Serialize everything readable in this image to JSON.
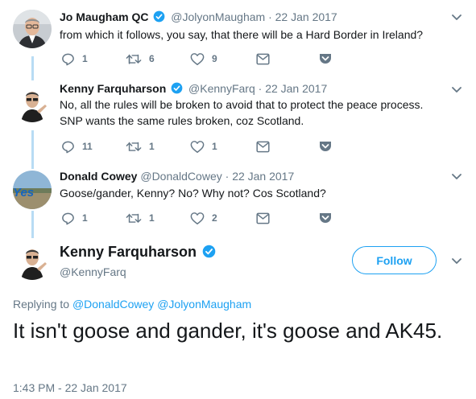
{
  "tweets": [
    {
      "name": "Jo Maugham QC",
      "handle": "@JolyonMaugham",
      "separator": "·",
      "date": "22 Jan 2017",
      "text": "from which it follows, you say, that there will be a Hard Border in Ireland?",
      "replies": "1",
      "retweets": "6",
      "likes": "9"
    },
    {
      "name": "Kenny Farquharson",
      "handle": "@KennyFarq",
      "separator": "·",
      "date": "22 Jan 2017",
      "text": "No, all the rules will be broken to avoid that to protect the peace process. SNP wants the same rules broken, coz Scotland.",
      "replies": "11",
      "retweets": "1",
      "likes": "1"
    },
    {
      "name": "Donald Cowey",
      "handle": "@DonaldCowey",
      "separator": "·",
      "date": "22 Jan 2017",
      "text": "Goose/gander, Kenny? No? Why not? Cos Scotland?",
      "replies": "1",
      "retweets": "1",
      "likes": "2",
      "avatar_text": "Yes"
    }
  ],
  "main_tweet": {
    "name": "Kenny Farquharson",
    "handle": "@KennyFarq",
    "follow_label": "Follow",
    "replying_prefix": "Replying to",
    "replying_to_1": "@DonaldCowey",
    "replying_to_2": "@JolyonMaugham",
    "text": "It isn't goose and gander, it's goose and AK45.",
    "timestamp": "1:43 PM - 22 Jan 2017"
  },
  "colors": {
    "accent": "#1da1f2",
    "muted": "#657786",
    "thread_line": "#b8dcf4",
    "text": "#14171a"
  },
  "icons": [
    "reply-icon",
    "retweet-icon",
    "like-icon",
    "message-icon",
    "pocket-icon",
    "chevron-down-icon",
    "verified-icon"
  ]
}
